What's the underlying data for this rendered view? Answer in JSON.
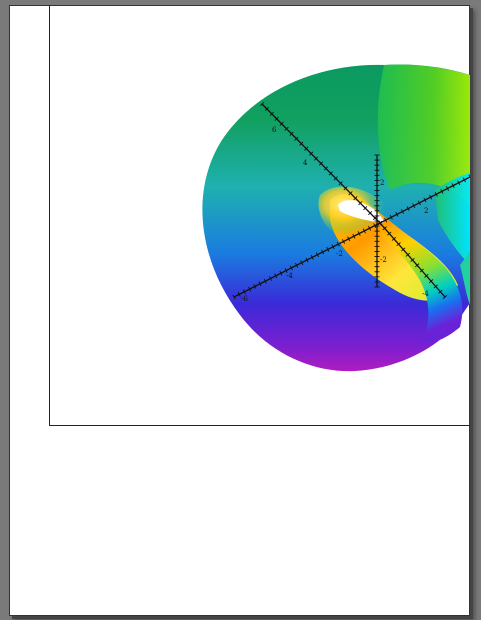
{
  "document": {
    "page_background": "#ffffff",
    "desktop_background": "#7a7a7a"
  },
  "plot": {
    "surface": "twisted-torus",
    "colormap": "hue-spectrum",
    "axes": {
      "axis_a_labels": [
        "6",
        "4",
        "2",
        "-2",
        "-4",
        "-6"
      ],
      "axis_b_labels": [
        "2",
        "-2",
        "-4"
      ],
      "axis_c_labels": [
        "2",
        "-2"
      ]
    }
  }
}
